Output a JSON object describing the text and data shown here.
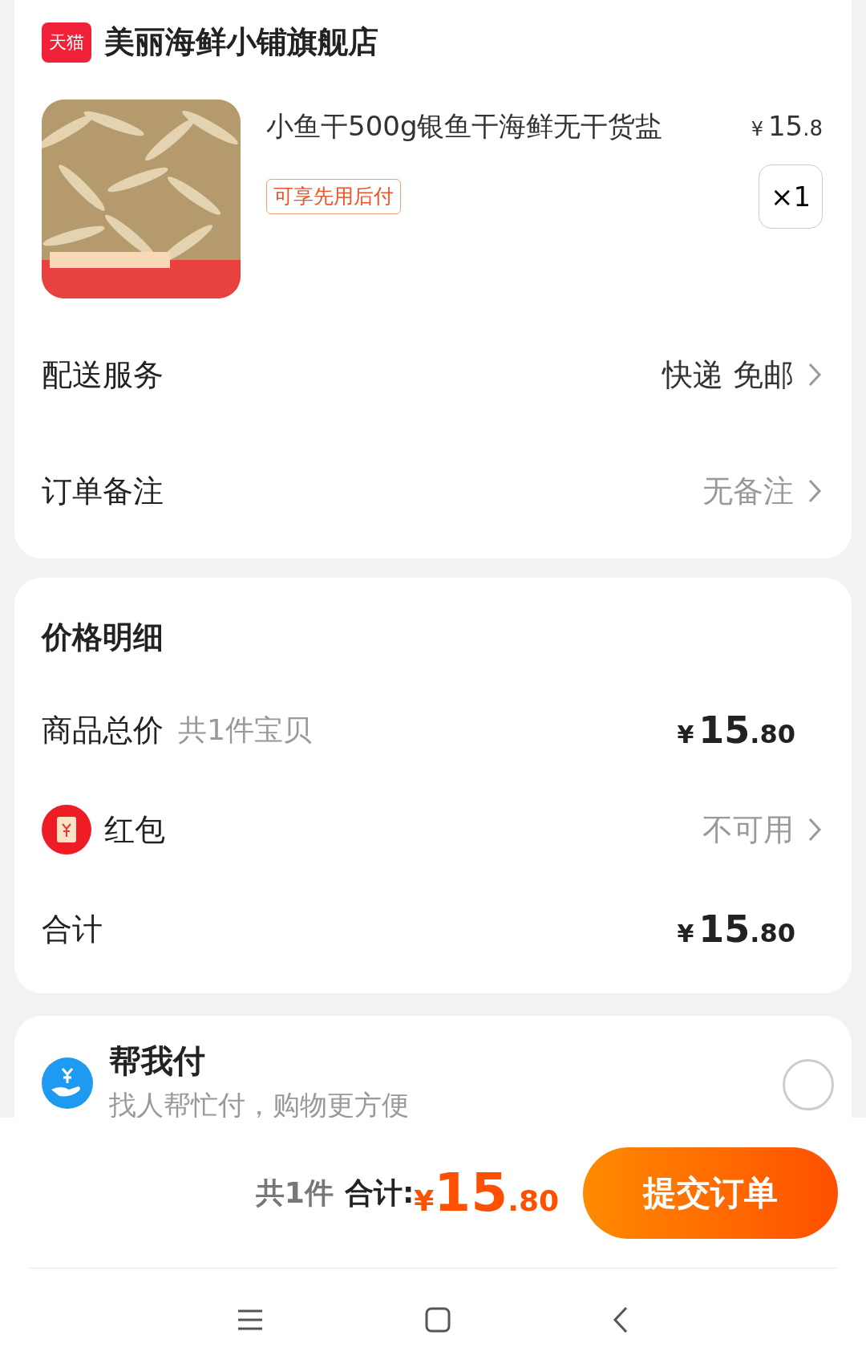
{
  "store": {
    "badge": "天猫",
    "name": "美丽海鲜小铺旗舰店"
  },
  "product": {
    "kind": "picture",
    "title": "小鱼干500g银鱼干海鲜无干货盐",
    "currency": "¥",
    "price_integer": "15",
    "price_decimal": ".8",
    "quantity": "×1",
    "tag": "可享先用后付"
  },
  "order_rows": [
    {
      "label": "配送服务",
      "value": "快递 免邮",
      "dimmed": false
    },
    {
      "label": "订单备注",
      "value": "无备注",
      "dimmed": true
    }
  ],
  "price_details": {
    "title": "价格明细",
    "rows": [
      {
        "kind": "amount",
        "label": "商品总价",
        "note": "共1件宝贝",
        "currency": "¥",
        "integer": "15",
        "decimal": ".80"
      },
      {
        "kind": "option",
        "label": "红包",
        "value": "不可用"
      },
      {
        "kind": "amount",
        "label": "合计",
        "currency": "¥",
        "integer": "15",
        "decimal": ".80"
      }
    ]
  },
  "pay_for_me": {
    "title": "帮我付",
    "subtitle": "找人帮忙付，购物更方便",
    "selected": false
  },
  "footer": {
    "count": "共1件",
    "total_label": "合计:",
    "currency": "¥",
    "integer": "15",
    "decimal": ".80",
    "submit": "提交订单"
  }
}
